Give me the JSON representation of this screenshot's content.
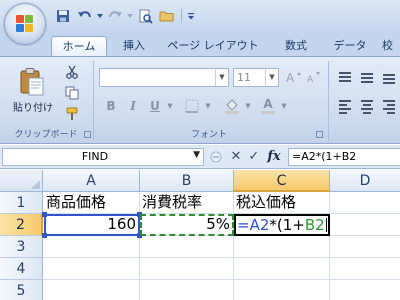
{
  "colors": {
    "title_bar": "#dde8f6",
    "ribbon": "#cfdcef",
    "selected_header": "#f7c96b",
    "ref_a2_color": "#3355cc",
    "ref_b2_color": "#2f8f2f"
  },
  "quick_access": {
    "icons": [
      "save-icon",
      "undo-icon",
      "redo-icon",
      "print-preview-icon",
      "open-icon",
      "customize-icon"
    ]
  },
  "ribbon": {
    "tabs": [
      {
        "label": "ホーム",
        "active": true
      },
      {
        "label": "挿入",
        "active": false
      },
      {
        "label": "ページ レイアウト",
        "active": false
      },
      {
        "label": "数式",
        "active": false
      },
      {
        "label": "データ",
        "active": false
      },
      {
        "label": "校",
        "active": false
      }
    ],
    "clipboard": {
      "paste_label": "貼り付け",
      "group_label": "クリップボード"
    },
    "font": {
      "font_name": "",
      "font_size": "11",
      "bold": "B",
      "italic": "I",
      "underline": "U",
      "font_color_letter": "A",
      "group_label": "フォント"
    }
  },
  "formula_bar": {
    "name_box": "FIND",
    "cancel_symbol": "✕",
    "enter_symbol": "✓",
    "fx_label": "fx",
    "formula_prefix": "=",
    "formula_ref_a": "A2",
    "formula_mid": "*(1+",
    "formula_ref_b": "B2",
    "formula_text": "=A2*(1+B2"
  },
  "sheet": {
    "columns": [
      "A",
      "B",
      "C",
      "D"
    ],
    "rows": [
      "1",
      "2",
      "3",
      "4",
      "5",
      "6"
    ],
    "active_column": "C",
    "active_row": "2",
    "cells": {
      "A1": "商品価格",
      "B1": "消費税率",
      "C1": "税込価格",
      "A2": "160",
      "B2": "5%",
      "C2_prefix": "=",
      "C2_ref_a": "A2",
      "C2_mid": "*(1+",
      "C2_ref_b": "B2"
    }
  }
}
